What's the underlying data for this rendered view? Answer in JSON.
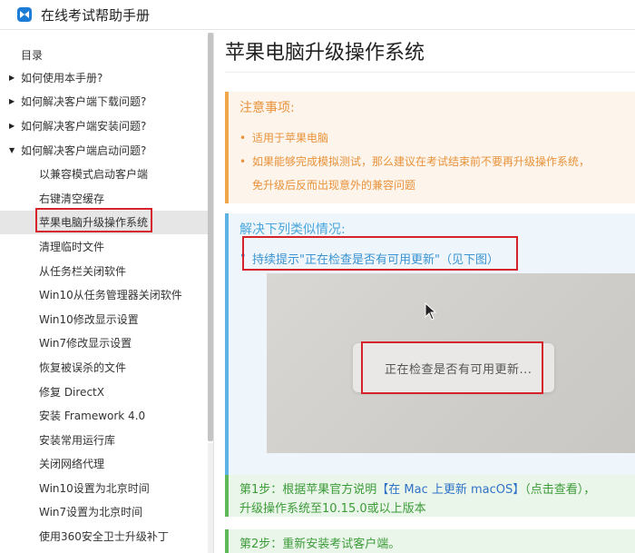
{
  "app": {
    "title": "在线考试帮助手册",
    "accent": "#1c7cd6"
  },
  "sidebar": {
    "toc_title": "目录",
    "items": [
      {
        "label": "如何使用本手册?",
        "type": "folder",
        "expanded": false
      },
      {
        "label": "如何解决客户端下载问题?",
        "type": "folder",
        "expanded": false
      },
      {
        "label": "如何解决客户端安装问题?",
        "type": "folder",
        "expanded": false
      },
      {
        "label": "如何解决客户端启动问题?",
        "type": "folder",
        "expanded": true
      },
      {
        "label": "以兼容模式启动客户端",
        "type": "leaf"
      },
      {
        "label": "右键清空缓存",
        "type": "leaf"
      },
      {
        "label": "苹果电脑升级操作系统",
        "type": "leaf",
        "selected": true
      },
      {
        "label": "清理临时文件",
        "type": "leaf"
      },
      {
        "label": "从任务栏关闭软件",
        "type": "leaf"
      },
      {
        "label": "Win10从任务管理器关闭软件",
        "type": "leaf"
      },
      {
        "label": "Win10修改显示设置",
        "type": "leaf"
      },
      {
        "label": "Win7修改显示设置",
        "type": "leaf"
      },
      {
        "label": "恢复被误杀的文件",
        "type": "leaf"
      },
      {
        "label": "修复 DirectX",
        "type": "leaf"
      },
      {
        "label": "安装 Framework 4.0",
        "type": "leaf"
      },
      {
        "label": "安装常用运行库",
        "type": "leaf"
      },
      {
        "label": "关闭网络代理",
        "type": "leaf"
      },
      {
        "label": "Win10设置为北京时间",
        "type": "leaf"
      },
      {
        "label": "Win7设置为北京时间",
        "type": "leaf"
      },
      {
        "label": "使用360安全卫士升级补丁",
        "type": "leaf"
      }
    ]
  },
  "main": {
    "page_title": "苹果电脑升级操作系统",
    "notice": {
      "heading": "注意事项:",
      "items": [
        "适用于苹果电脑",
        "如果能够完成模拟测试，那么建议在考试结束前不要再升级操作系统，"
      ],
      "continuation": "免升级后反而出现意外的兼容问题",
      "color": "#e8923a"
    },
    "solve": {
      "heading": "解决下列类似情况:",
      "item": "持续提示\"正在检查是否有可用更新\"（见下图）",
      "color": "#3a93d2",
      "screenshot_text": "正在检查是否有可用更新..."
    },
    "step1": {
      "prefix": "第1步：根据苹果官方说明",
      "link": "【在 Mac 上更新 macOS】",
      "suffix": "（点击查看），",
      "line2": "升级操作系统至10.15.0或以上版本"
    },
    "step2": {
      "text": "第2步：重新安装考试客户端。"
    },
    "highlight_color": "#d6222b"
  }
}
